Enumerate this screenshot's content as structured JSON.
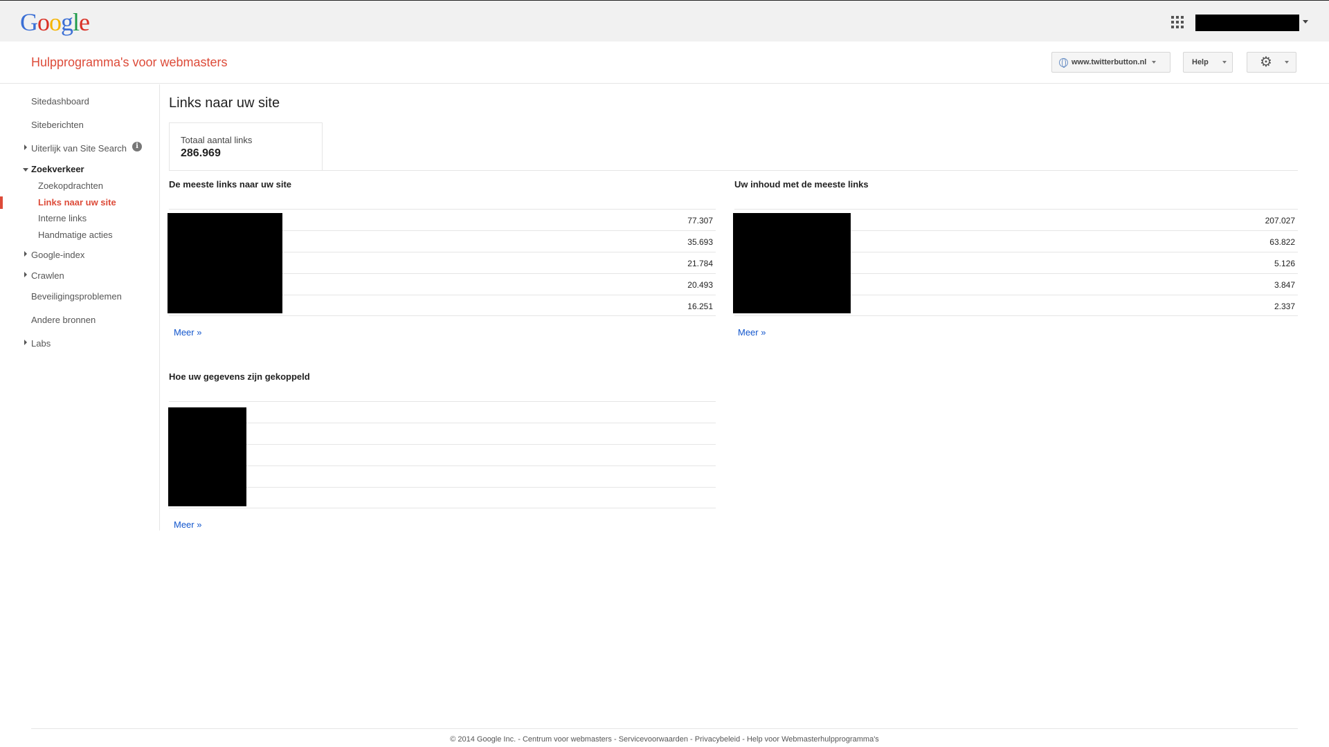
{
  "header": {
    "logo": "Google",
    "logo_letters": [
      {
        "ch": "G",
        "color": "#3b6fd5"
      },
      {
        "ch": "o",
        "color": "#d93025"
      },
      {
        "ch": "o",
        "color": "#f5b400"
      },
      {
        "ch": "g",
        "color": "#3b6fd5"
      },
      {
        "ch": "l",
        "color": "#1e9a4a"
      },
      {
        "ch": "e",
        "color": "#d93025"
      }
    ],
    "apps_icon": "apps-grid-icon"
  },
  "product": {
    "name": "Hulpprogramma's voor webmasters",
    "site_selector": "www.twitterbutton.nl",
    "help": "Help",
    "settings_icon": "gear-icon"
  },
  "nav": {
    "items": [
      {
        "label": "Sitedashboard"
      },
      {
        "label": "Siteberichten"
      },
      {
        "label": "Uiterlijk van Site Search"
      },
      {
        "label": "Zoekverkeer"
      },
      {
        "label": "Zoekopdrachten"
      },
      {
        "label": "Links naar uw site"
      },
      {
        "label": "Interne links"
      },
      {
        "label": "Handmatige acties"
      },
      {
        "label": "Google-index"
      },
      {
        "label": "Crawlen"
      },
      {
        "label": "Beveiligingsproblemen"
      },
      {
        "label": "Andere bronnen"
      },
      {
        "label": "Labs"
      }
    ],
    "info_glyph": "i"
  },
  "main": {
    "title": "Links naar uw site",
    "total_label": "Totaal aantal links",
    "total_value": "286.969",
    "sections": [
      {
        "title": "De meeste links naar uw site",
        "values": [
          "77.307",
          "35.693",
          "21.784",
          "20.493",
          "16.251"
        ],
        "more": "Meer »"
      },
      {
        "title": "Uw inhoud met de meeste links",
        "values": [
          "207.027",
          "63.822",
          "5.126",
          "3.847",
          "2.337"
        ],
        "more": "Meer »"
      },
      {
        "title": "Hoe uw gegevens zijn gekoppeld",
        "values": [
          "",
          "",
          "",
          "",
          ""
        ],
        "more": "Meer »"
      }
    ]
  },
  "footer": {
    "copyright": "© 2014 Google Inc.",
    "links": [
      "Centrum voor webmasters",
      "Servicevoorwaarden",
      "Privacybeleid",
      "Help voor Webmasterhulpprogramma's"
    ]
  },
  "colors": {
    "accent": "#dd4b39",
    "link": "#1155cc"
  }
}
